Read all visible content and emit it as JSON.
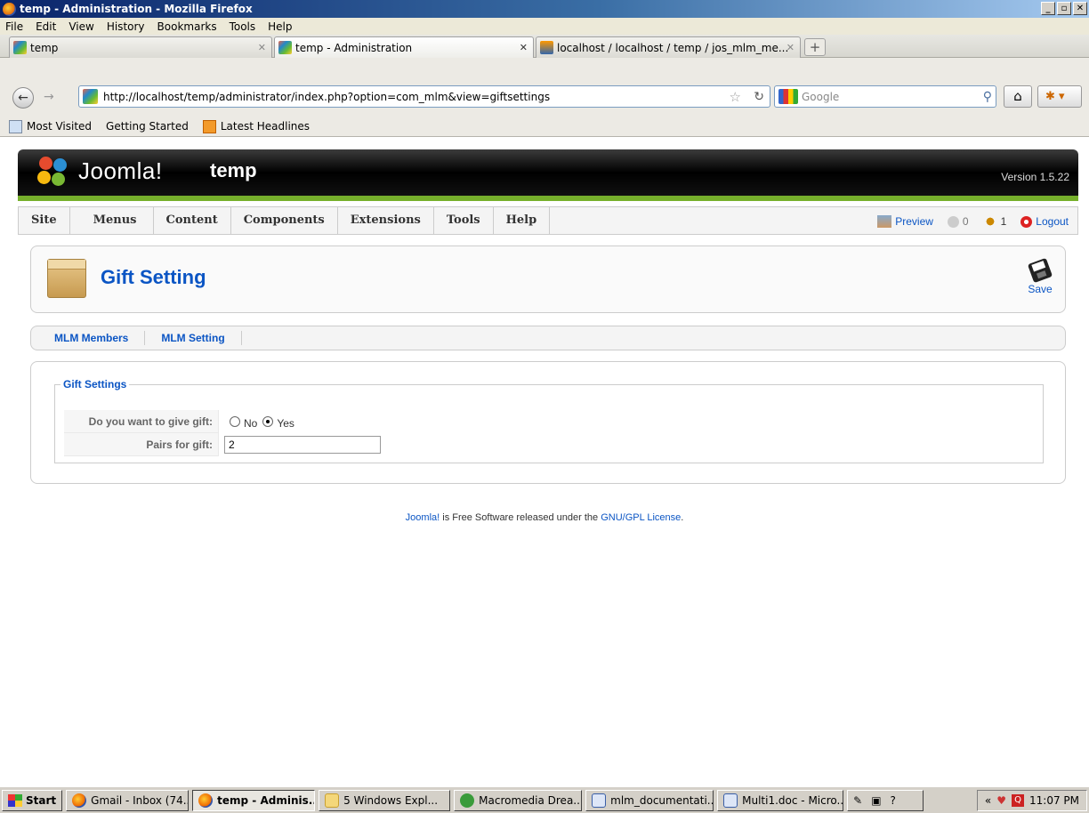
{
  "window": {
    "title": "temp - Administration - Mozilla Firefox"
  },
  "menubar": [
    "File",
    "Edit",
    "View",
    "History",
    "Bookmarks",
    "Tools",
    "Help"
  ],
  "tabs": [
    {
      "label": "temp",
      "active": false
    },
    {
      "label": "temp - Administration",
      "active": true
    },
    {
      "label": "localhost / localhost / temp / jos_mlm_me...",
      "active": false
    }
  ],
  "url": "http://localhost/temp/administrator/index.php?option=com_mlm&view=giftsettings",
  "search": {
    "placeholder": "Google"
  },
  "bookmarks": [
    "Most Visited",
    "Getting Started",
    "Latest Headlines"
  ],
  "joomla": {
    "brand": "Joomla!",
    "site_name": "temp",
    "version": "Version 1.5.22",
    "menu": [
      "Site",
      "Menus",
      "Content",
      "Components",
      "Extensions",
      "Tools",
      "Help"
    ],
    "status": {
      "preview": "Preview",
      "messages": "0",
      "users": "1",
      "logout": "Logout"
    }
  },
  "toolbar": {
    "title": "Gift Setting",
    "save_label": "Save"
  },
  "submenu": [
    "MLM Members",
    "MLM Setting"
  ],
  "form": {
    "legend": "Gift Settings",
    "give_gift_label": "Do you want to give gift:",
    "option_no": "No",
    "option_yes": "Yes",
    "selected": "Yes",
    "pairs_label": "Pairs for gift:",
    "pairs_value": "2"
  },
  "footer": {
    "prefix": "Joomla!",
    "middle": " is Free Software released under the ",
    "license": "GNU/GPL License",
    "suffix": "."
  },
  "taskbar": {
    "start": "Start",
    "items": [
      {
        "label": "Gmail - Inbox (74...",
        "active": false
      },
      {
        "label": "temp - Adminis...",
        "active": true
      },
      {
        "label": "5 Windows Expl...",
        "active": false
      },
      {
        "label": "Macromedia Drea...",
        "active": false
      },
      {
        "label": "mlm_documentati...",
        "active": false
      },
      {
        "label": "Multi1.doc - Micro...",
        "active": false
      }
    ],
    "clock": "11:07 PM"
  },
  "colors": {
    "joomla_blue": "#0b55c4",
    "joomla_green": "#77b02c"
  }
}
